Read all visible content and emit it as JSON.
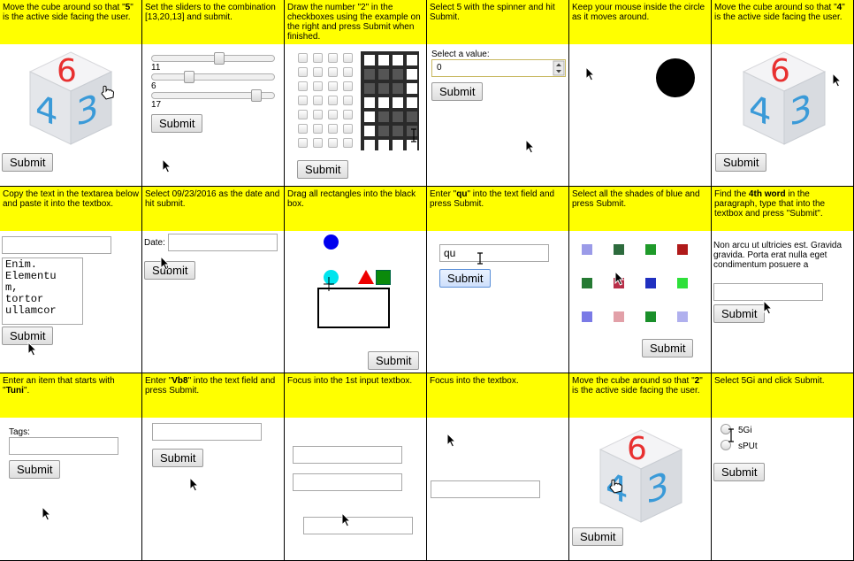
{
  "cells": {
    "r1c1": {
      "instruction_pre": "Move the cube around so that \"",
      "instruction_bold": "5",
      "instruction_post": "\" is the active side facing the user.",
      "cube_top": "6",
      "cube_left": "4",
      "cube_right": "3",
      "submit": "Submit"
    },
    "r1c2": {
      "instruction": "Set the sliders to the combination [13,20,13] and submit.",
      "slider_values": [
        "11",
        "6",
        "17"
      ],
      "submit": "Submit"
    },
    "r1c3": {
      "instruction": "Draw the number \"2\" in the checkboxes using the example on the right and press Submit when finished.",
      "submit": "Submit"
    },
    "r1c4": {
      "instruction": "Select 5 with the spinner and hit Submit.",
      "label": "Select a value:",
      "value": "0",
      "submit": "Submit"
    },
    "r1c5": {
      "instruction": "Keep your mouse inside the circle as it moves around."
    },
    "r1c6": {
      "instruction_pre": "Move the cube around so that \"",
      "instruction_bold": "4",
      "instruction_post": "\" is the active side facing the user.",
      "cube_top": "6",
      "cube_left": "4",
      "cube_right": "3",
      "submit": "Submit"
    },
    "r2c1": {
      "instruction": "Copy the text in the textarea below and paste it into the textbox.",
      "textarea_lines": [
        "Enim.",
        "Elementu",
        "m,",
        "tortor",
        "ullamcor"
      ],
      "submit": "Submit"
    },
    "r2c2": {
      "instruction": "Select 09/23/2016 as the date and hit submit.",
      "date_label": "Date:",
      "submit": "Submit"
    },
    "r2c3": {
      "instruction": "Drag all rectangles into the black box.",
      "submit": "Submit"
    },
    "r2c4": {
      "instruction_pre": "Enter \"",
      "instruction_bold": "qu",
      "instruction_post": "\" into the text field and press Submit.",
      "value": "qu",
      "submit": "Submit"
    },
    "r2c5": {
      "instruction": "Select all the shades of blue and press Submit.",
      "submit": "Submit"
    },
    "r2c6": {
      "instruction_pre": "Find the ",
      "instruction_bold": "4th word",
      "instruction_post": " in the paragraph, type that into the textbox and press \"Submit\".",
      "paragraph": "Non arcu ut ultricies est. Gravida gravida. Porta erat nulla eget condimentum posuere a",
      "submit": "Submit"
    },
    "r3c1": {
      "instruction_pre": "Enter an item that starts with \"",
      "instruction_bold": "Tuni",
      "instruction_post": "\".",
      "tags_label": "Tags:",
      "submit": "Submit"
    },
    "r3c2": {
      "instruction_pre": "Enter \"",
      "instruction_bold": "Vb8",
      "instruction_post": "\" into the text field and press Submit.",
      "submit": "Submit"
    },
    "r3c3": {
      "instruction": "Focus into the 1st input textbox."
    },
    "r3c4": {
      "instruction": "Focus into the textbox."
    },
    "r3c5": {
      "instruction_pre": "Move the cube around so that \"",
      "instruction_bold": "2",
      "instruction_post": "\" is the active side facing the user.",
      "cube_top": "6",
      "cube_left": "4",
      "cube_right": "3",
      "submit": "Submit"
    },
    "r3c6": {
      "instruction": "Select 5Gi and click Submit.",
      "options": [
        "5Gi",
        "sPUt"
      ],
      "submit": "Submit"
    }
  },
  "colors": {
    "instruction_bg": "#ffff00",
    "cube_red": "#e83030",
    "cube_blue": "#3a9ad8"
  },
  "icons": [
    "mouse-pointer-icon",
    "hand-pointer-icon",
    "text-cursor-icon",
    "spinner-arrows-icon"
  ]
}
